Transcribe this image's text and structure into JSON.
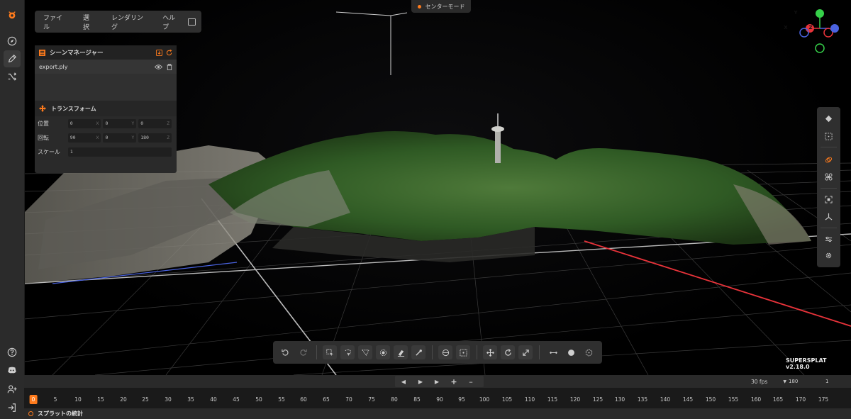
{
  "menu": {
    "items": [
      "ファイル",
      "選択",
      "レンダリング",
      "ヘルプ"
    ]
  },
  "center_mode": {
    "label": "センターモード"
  },
  "scene_manager": {
    "title": "シーンマネージャー",
    "file_name": "export.ply"
  },
  "transform": {
    "title": "トランスフォーム",
    "position": {
      "label": "位置",
      "x": "0",
      "y": "0",
      "z": "0"
    },
    "rotation": {
      "label": "回転",
      "x": "90",
      "y": "0",
      "z": "180"
    },
    "scale": {
      "label": "スケール",
      "value": "1"
    },
    "axes": {
      "x": "X",
      "y": "Y",
      "z": "Z"
    }
  },
  "gizmo": {
    "x": "X",
    "y": "Y",
    "z": "Z"
  },
  "version": "SUPERSPLAT v2.18.0",
  "timeline": {
    "current_frame": "0",
    "ticks": [
      "5",
      "10",
      "15",
      "20",
      "25",
      "30",
      "35",
      "40",
      "45",
      "50",
      "55",
      "60",
      "65",
      "70",
      "75",
      "80",
      "85",
      "90",
      "95",
      "100",
      "105",
      "110",
      "115",
      "120",
      "125",
      "130",
      "135",
      "140",
      "145",
      "150",
      "155",
      "160",
      "165",
      "170",
      "175"
    ],
    "fps": "30 fps",
    "frames": "180",
    "speed": "1"
  },
  "stats": {
    "label": "スプラットの統計"
  },
  "colors": {
    "accent": "#ff7b1c",
    "panel": "#2a2a2a",
    "rail": "#2b2b2b",
    "x_axis": "#e8333a",
    "y_axis": "#36d14a",
    "z_axis": "#4a63e0"
  }
}
